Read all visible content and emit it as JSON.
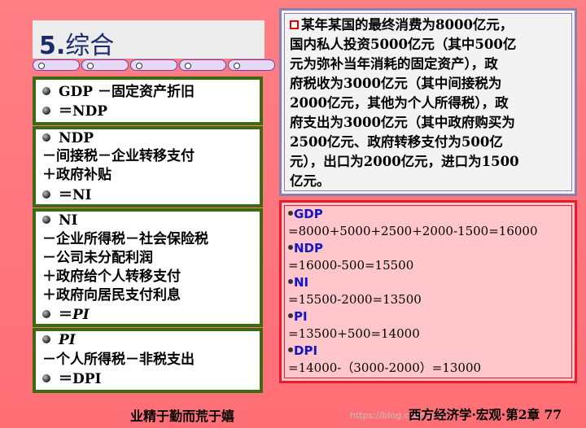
{
  "slide": {
    "title_number": "5.",
    "title_text": "综合"
  },
  "left_boxes": [
    {
      "lines": [
        {
          "bullet": true,
          "text": "GDP －固定资产折旧"
        },
        {
          "bullet": true,
          "text": "＝NDP"
        }
      ]
    },
    {
      "lines": [
        {
          "bullet": true,
          "text": "NDP"
        },
        {
          "bullet": false,
          "text": "－间接税－企业转移支付"
        },
        {
          "bullet": false,
          "text": "＋政府补贴"
        },
        {
          "bullet": true,
          "text": "＝NI"
        }
      ]
    },
    {
      "lines": [
        {
          "bullet": true,
          "text": "NI"
        },
        {
          "bullet": false,
          "text": "－企业所得税－社会保险税"
        },
        {
          "bullet": false,
          "text": "－公司未分配利润"
        },
        {
          "bullet": false,
          "text": "＋政府给个人转移支付"
        },
        {
          "bullet": false,
          "text": "＋政府向居民支付利息"
        },
        {
          "bullet": true,
          "text": "＝",
          "italic_text": "PI"
        }
      ]
    },
    {
      "lines": [
        {
          "bullet": true,
          "italic_text": "PI"
        },
        {
          "bullet": false,
          "text": "－个人所得税－非税支出"
        },
        {
          "bullet": true,
          "text": "＝DPI"
        }
      ]
    }
  ],
  "problem": {
    "lines": [
      "某年某国的最终消费为8000亿元，",
      "国内私人投资5000亿元（其中500亿",
      "元为弥补当年消耗的固定资产），政",
      "府税收为3000亿元（其中间接税为",
      "2000亿元，其他为个人所得税），政",
      "府支出为3000亿元（其中政府购买为",
      "2500亿元、政府转移支付为500亿",
      "元），出口为2000亿元，进口为1500",
      "亿元。"
    ]
  },
  "solution": [
    {
      "label": "GDP",
      "formula": "=8000+5000+2500+2000-1500=16000"
    },
    {
      "label": "NDP",
      "formula": "=16000-500=15500"
    },
    {
      "label": "NI",
      "formula": "=15500-2000=13500"
    },
    {
      "label": "PI",
      "formula": "=13500+500=14000"
    },
    {
      "label": "DPI",
      "formula": "=14000-（3000-2000）=13000"
    }
  ],
  "footer": {
    "motto": "业精于勤而荒于嬉",
    "course": "西方经济学·宏观·第2章 77",
    "watermark": "https://blog.csdn.net"
  }
}
